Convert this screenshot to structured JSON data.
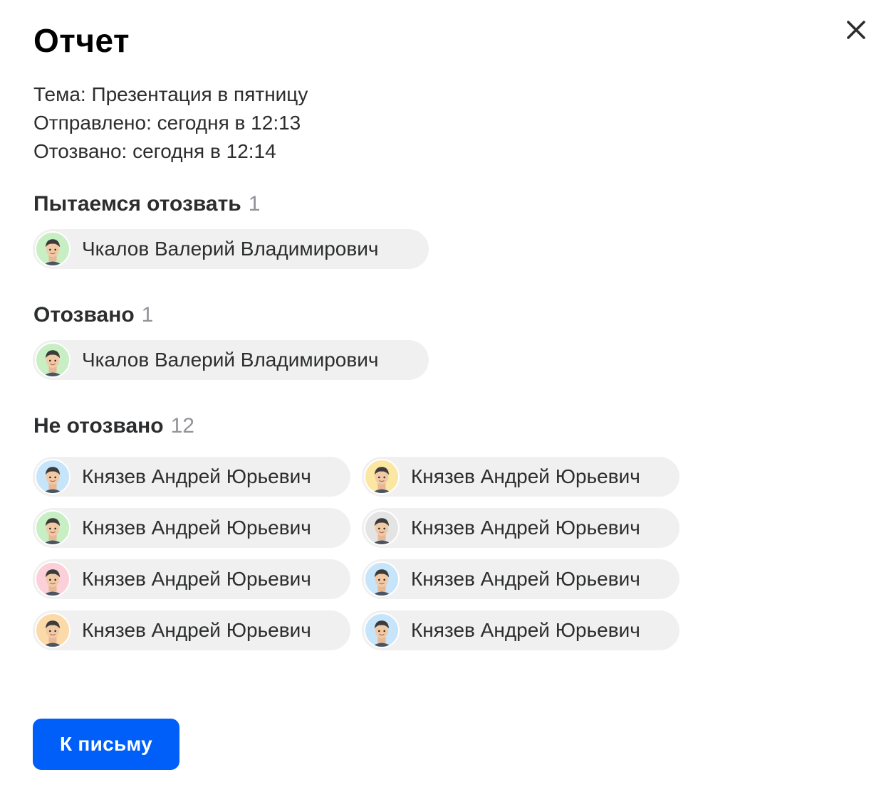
{
  "dialog": {
    "title": "Отчет",
    "close_icon": "close-icon"
  },
  "meta": {
    "subject": "Тема: Презентация в пятницу",
    "sent": "Отправлено: сегодня в 12:13",
    "recalled": "Отозвано: сегодня в 12:14"
  },
  "sections": {
    "trying": {
      "title": "Пытаемся отозвать",
      "count": "1",
      "people": [
        {
          "name": "Чкалов Валерий Владимирович",
          "avatar_bg": "#c8efc4"
        }
      ]
    },
    "recalled": {
      "title": "Отозвано",
      "count": "1",
      "people": [
        {
          "name": "Чкалов Валерий Владимирович",
          "avatar_bg": "#c8efc4"
        }
      ]
    },
    "not_recalled": {
      "title": "Не отозвано",
      "count": "12",
      "people": [
        {
          "name": "Князев Андрей Юрьевич",
          "avatar_bg": "#c6e4fa"
        },
        {
          "name": "Князев Андрей Юрьевич",
          "avatar_bg": "#fbe6a2"
        },
        {
          "name": "Князев Андрей Юрьевич",
          "avatar_bg": "#c8efc4"
        },
        {
          "name": "Князев Андрей Юрьевич",
          "avatar_bg": "#e4e4e4"
        },
        {
          "name": "Князев Андрей Юрьевич",
          "avatar_bg": "#fbd0d8"
        },
        {
          "name": "Князев Андрей Юрьевич",
          "avatar_bg": "#c6e4fa"
        },
        {
          "name": "Князев Андрей Юрьевич",
          "avatar_bg": "#fcd9a8"
        },
        {
          "name": "Князев Андрей Юрьевич",
          "avatar_bg": "#c6e4fa"
        }
      ]
    }
  },
  "actions": {
    "to_letter": "К письму"
  },
  "colors": {
    "accent": "#005ff9",
    "chip_bg": "#f0f0f0",
    "count_text": "#919399"
  }
}
